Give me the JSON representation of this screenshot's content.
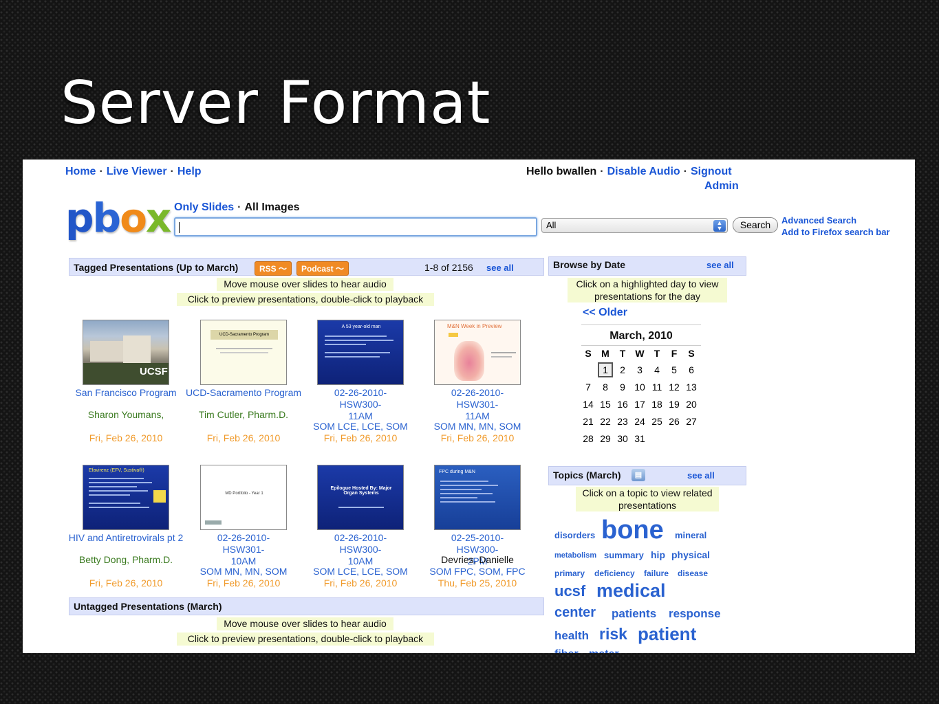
{
  "slide": {
    "title": "Server Format"
  },
  "topnav": {
    "links": [
      "Home",
      "Live Viewer",
      "Help"
    ],
    "sep": "·",
    "greeting": "Hello bwallen",
    "user_links": [
      "Disable Audio",
      "Signout"
    ],
    "admin": "Admin"
  },
  "logo": {
    "p": "p",
    "b": "b",
    "o": "o",
    "x": "x"
  },
  "search": {
    "mode_active": "Only Slides",
    "mode_other": "All Images",
    "value": "",
    "scope": "All",
    "button": "Search",
    "advanced": "Advanced Search",
    "firefox": "Add to Firefox search bar"
  },
  "tagged": {
    "title": "Tagged Presentations (Up to March)",
    "rss": "RSS",
    "podcast": "Podcast",
    "range": "1-8 of 2156",
    "see_all": "see all",
    "note1": "Move mouse over slides to hear audio",
    "note2": "Click to preview presentations, double-click to playback",
    "items": [
      {
        "title": "San Francisco Program",
        "author": "Sharon Youmans,",
        "tags": "",
        "date": "Fri, Feb 26, 2010"
      },
      {
        "title": "UCD-Sacramento Program",
        "author": "Tim Cutler, Pharm.D.",
        "tags": "",
        "date": "Fri, Feb 26, 2010",
        "thumb_text": "UCD-Sacramento Program"
      },
      {
        "title": "02-26-2010-HSW300-11AM",
        "author": "",
        "tags": "SOM LCE, LCE, SOM",
        "date": "Fri, Feb 26, 2010",
        "thumb_text": "A 53 year-old man"
      },
      {
        "title": "02-26-2010-HSW301-11AM",
        "author": "",
        "tags": "SOM MN, MN, SOM",
        "date": "Fri, Feb 26, 2010",
        "thumb_text": "M&N Week in Preview"
      },
      {
        "title": "HIV and Antiretrovirals pt 2",
        "author": "Betty Dong, Pharm.D.",
        "tags": "",
        "date": "Fri, Feb 26, 2010",
        "thumb_text": "Efavirenz (EFV, Sustiva®)"
      },
      {
        "title": "02-26-2010-HSW301-10AM",
        "author": "",
        "tags": "SOM MN, MN, SOM",
        "date": "Fri, Feb 26, 2010",
        "thumb_text": "MD Portfolio - Year 1"
      },
      {
        "title": "02-26-2010-HSW300-10AM",
        "author": "",
        "tags": "SOM LCE, LCE, SOM",
        "date": "Fri, Feb 26, 2010",
        "thumb_text": "Epilogue Hosted By: Major Organ Systems"
      },
      {
        "title": "02-25-2010-HSW300-2PM",
        "author": "Devries, Danielle",
        "tags": "SOM FPC, SOM, FPC",
        "date": "Thu, Feb 25, 2010",
        "thumb_text": "FPC during M&N"
      }
    ]
  },
  "untagged": {
    "title": "Untagged Presentations (March)",
    "note1": "Move mouse over slides to hear audio",
    "note2": "Click to preview presentations, double-click to playback"
  },
  "browse": {
    "title": "Browse by Date",
    "see_all": "see all",
    "note": "Click on a highlighted day to view presentations for the day",
    "older": "<< Older",
    "month": "March, 2010",
    "weekdays": [
      "S",
      "M",
      "T",
      "W",
      "T",
      "F",
      "S"
    ],
    "weeks": [
      [
        "",
        "1",
        "2",
        "3",
        "4",
        "5",
        "6"
      ],
      [
        "7",
        "8",
        "9",
        "10",
        "11",
        "12",
        "13"
      ],
      [
        "14",
        "15",
        "16",
        "17",
        "18",
        "19",
        "20"
      ],
      [
        "21",
        "22",
        "23",
        "24",
        "25",
        "26",
        "27"
      ],
      [
        "28",
        "29",
        "30",
        "31",
        "",
        "",
        ""
      ]
    ]
  },
  "topics": {
    "title": "Topics (March)",
    "see_all": "see all",
    "note": "Click on a topic to view related presentations",
    "tags": [
      "disorders",
      "bone",
      "mineral",
      "metabolism",
      "summary",
      "hip",
      "physical",
      "primary",
      "deficiency",
      "failure",
      "disease",
      "ucsf",
      "medical",
      "center",
      "patients",
      "response",
      "health",
      "risk",
      "patient",
      "fiber",
      "meter"
    ]
  },
  "colors": {
    "link": "#1a56d6",
    "header_bar": "#dde3fb",
    "note_bg": "#f5fad2",
    "date": "#f09a2a",
    "author": "#3a7a1f"
  }
}
